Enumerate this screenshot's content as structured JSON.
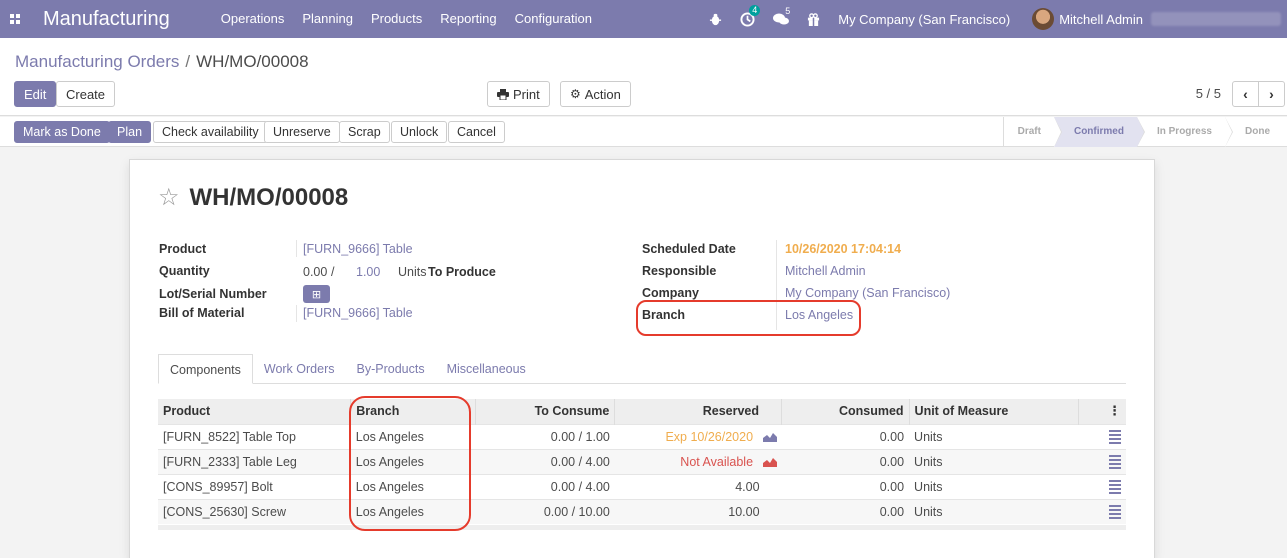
{
  "navbar": {
    "app_title": "Manufacturing",
    "menu": [
      "Operations",
      "Planning",
      "Products",
      "Reporting",
      "Configuration"
    ],
    "activity_count": "4",
    "messages_count": "5",
    "company": "My Company (San Francisco)",
    "user": "Mitchell Admin"
  },
  "breadcrumb": {
    "parent": "Manufacturing Orders",
    "separator": "/",
    "current": "WH/MO/00008"
  },
  "toolbar": {
    "edit": "Edit",
    "create": "Create",
    "print": "Print",
    "action": "Action",
    "pager": "5 / 5"
  },
  "statusbar": {
    "buttons": [
      "Mark as Done",
      "Plan",
      "Check availability",
      "Unreserve",
      "Scrap",
      "Unlock",
      "Cancel"
    ],
    "stages": [
      "Draft",
      "Confirmed",
      "In Progress",
      "Done"
    ],
    "active_stage": "Confirmed"
  },
  "form": {
    "title": "WH/MO/00008",
    "left": {
      "product_label": "Product",
      "product_value": "[FURN_9666] Table",
      "quantity_label": "Quantity",
      "quantity_produced": "0.00",
      "quantity_sep": "/",
      "quantity_total": "1.00",
      "quantity_uom": "Units",
      "quantity_suffix": "To Produce",
      "lot_label": "Lot/Serial Number",
      "bom_label": "Bill of Material",
      "bom_value": "[FURN_9666] Table"
    },
    "right": {
      "scheduled_label": "Scheduled Date",
      "scheduled_value": "10/26/2020 17:04:14",
      "responsible_label": "Responsible",
      "responsible_value": "Mitchell Admin",
      "company_label": "Company",
      "company_value": "My Company (San Francisco)",
      "branch_label": "Branch",
      "branch_value": "Los Angeles"
    }
  },
  "tabs": [
    "Components",
    "Work Orders",
    "By-Products",
    "Miscellaneous"
  ],
  "components": {
    "headers": {
      "product": "Product",
      "branch": "Branch",
      "to_consume": "To Consume",
      "reserved": "Reserved",
      "consumed": "Consumed",
      "uom": "Unit of Measure"
    },
    "rows": [
      {
        "product": "[FURN_8522] Table Top",
        "branch": "Los Angeles",
        "to_consume": "0.00 / 1.00",
        "reserved": "Exp 10/26/2020",
        "consumed": "0.00",
        "uom": "Units"
      },
      {
        "product": "[FURN_2333] Table Leg",
        "branch": "Los Angeles",
        "to_consume": "0.00 / 4.00",
        "reserved": "Not Available",
        "consumed": "0.00",
        "uom": "Units"
      },
      {
        "product": "[CONS_89957] Bolt",
        "branch": "Los Angeles",
        "to_consume": "0.00 / 4.00",
        "reserved": "4.00",
        "consumed": "0.00",
        "uom": "Units"
      },
      {
        "product": "[CONS_25630] Screw",
        "branch": "Los Angeles",
        "to_consume": "0.00 / 10.00",
        "reserved": "10.00",
        "consumed": "0.00",
        "uom": "Units"
      }
    ]
  },
  "colors": {
    "brand": "#7c7bad",
    "scheduled": "#f0ad4e",
    "consumed": "#28a745",
    "not_available": "#d9534f",
    "highlight": "#e53b2c"
  }
}
